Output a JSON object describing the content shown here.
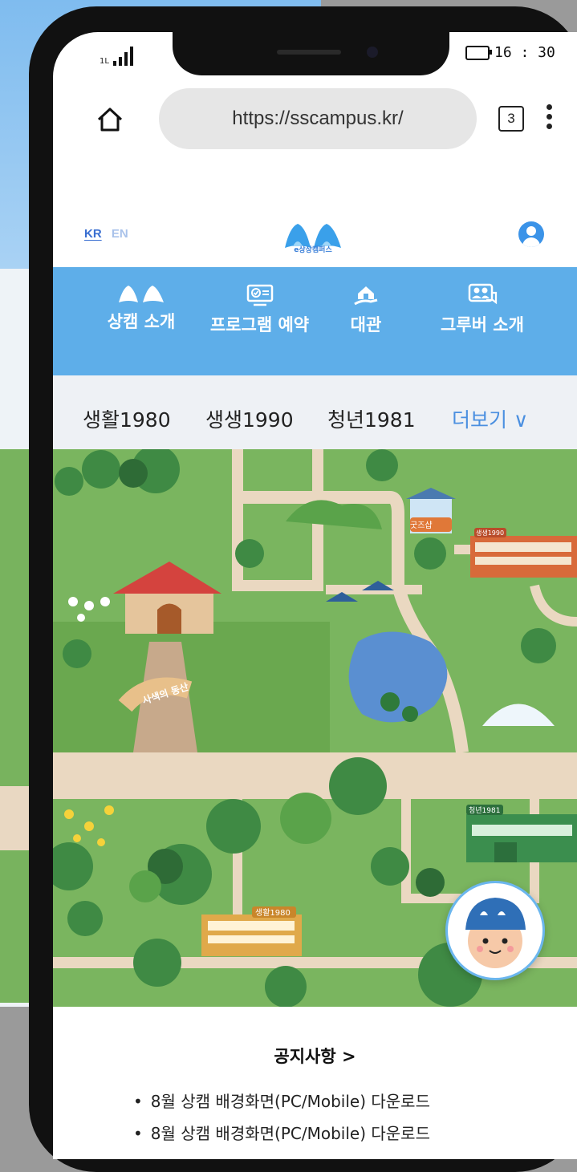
{
  "status_bar": {
    "time": "16 : 30",
    "network": "1L"
  },
  "browser": {
    "url": "https://sscampus.kr/",
    "tab_count": "3"
  },
  "header": {
    "lang_kr": "KR",
    "lang_en": "EN",
    "logo_text": "e상상캠퍼스"
  },
  "nav": {
    "items": [
      {
        "label": "상캠 소개",
        "icon": "logo-icon"
      },
      {
        "label": "프로그램 예약",
        "icon": "monitor-check-icon"
      },
      {
        "label": "대관",
        "icon": "house-hand-icon"
      },
      {
        "label": "그루버 소개",
        "icon": "people-chat-icon"
      }
    ]
  },
  "subnav": {
    "items": [
      "생활1980",
      "생생1990",
      "청년1981"
    ],
    "more": "더보기 ∨"
  },
  "map": {
    "labels": {
      "goods": "굿즈샵",
      "saengsaeng": "생생1990",
      "cheongnyeon": "청년1981",
      "saenghwal": "생활1980",
      "hill": "사색의 동산"
    }
  },
  "notice": {
    "title": "공지사항 >",
    "items": [
      "8월 상캠 배경화면(PC/Mobile) 다운로드",
      "8월 상캠 배경화면(PC/Mobile) 다운로드"
    ]
  },
  "colors": {
    "accent": "#5eaee9",
    "brand": "#3b93e8",
    "map": "#7ab55f"
  }
}
